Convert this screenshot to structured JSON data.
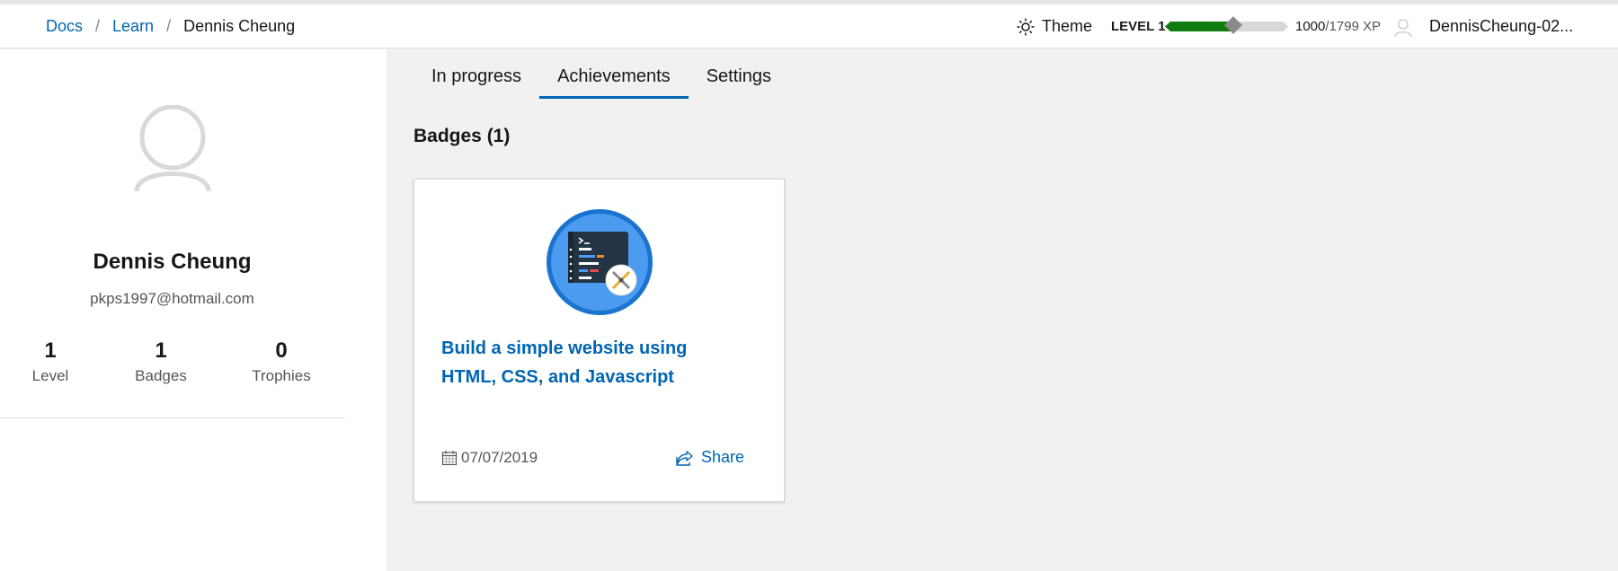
{
  "header": {
    "breadcrumb": [
      "Docs",
      "Learn",
      "Dennis Cheung"
    ],
    "theme_label": "Theme",
    "level_label": "LEVEL 1",
    "xp_current": "1000",
    "xp_max": "/1799 XP",
    "xp_progress": 0.556,
    "user_name": "DennisCheung-02..."
  },
  "profile": {
    "name": "Dennis Cheung",
    "email": "pkps1997@hotmail.com",
    "stats": [
      {
        "value": "1",
        "label": "Level"
      },
      {
        "value": "1",
        "label": "Badges"
      },
      {
        "value": "0",
        "label": "Trophies"
      }
    ]
  },
  "tabs": [
    {
      "label": "In progress",
      "active": false
    },
    {
      "label": "Achievements",
      "active": true
    },
    {
      "label": "Settings",
      "active": false
    }
  ],
  "badges": {
    "title": "Badges (1)",
    "items": [
      {
        "title": "Build a simple website using HTML, CSS, and Javascript",
        "date": "07/07/2019",
        "share_label": "Share",
        "icon": "code-editor-tools-icon"
      }
    ]
  },
  "colors": {
    "accent": "#0065b3",
    "xp_fill": "#107c10",
    "badge_ring": "#1b73d0"
  }
}
